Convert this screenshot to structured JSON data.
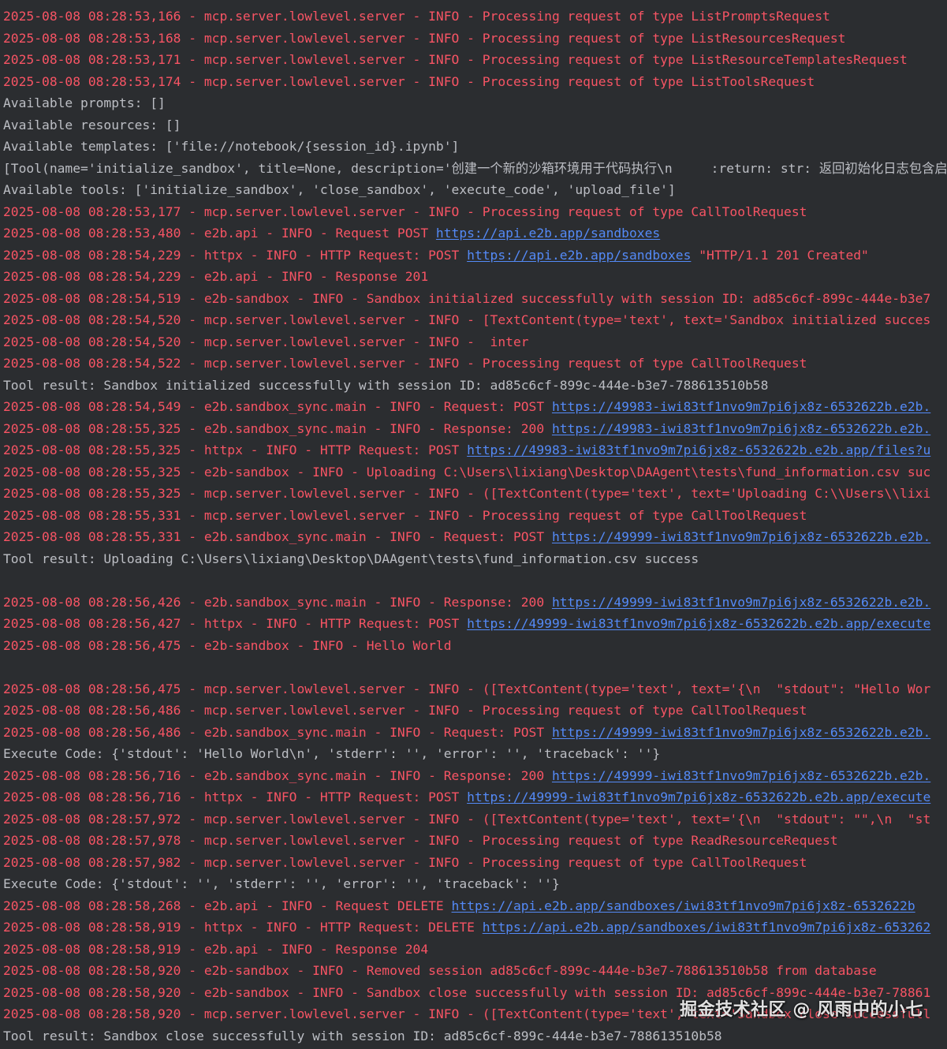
{
  "colors": {
    "background": "#2b2d30",
    "stderr_text": "#f75464",
    "stdout_text": "#bcbec4",
    "link": "#548af7"
  },
  "watermark": "掘金技术社区 @ 风雨中的小七",
  "lines": [
    {
      "kind": "err",
      "text": "2025-08-08 08:28:53,166 - mcp.server.lowlevel.server - INFO - Processing request of type ListPromptsRequest"
    },
    {
      "kind": "err",
      "text": "2025-08-08 08:28:53,168 - mcp.server.lowlevel.server - INFO - Processing request of type ListResourcesRequest"
    },
    {
      "kind": "err",
      "text": "2025-08-08 08:28:53,171 - mcp.server.lowlevel.server - INFO - Processing request of type ListResourceTemplatesRequest"
    },
    {
      "kind": "err",
      "text": "2025-08-08 08:28:53,174 - mcp.server.lowlevel.server - INFO - Processing request of type ListToolsRequest"
    },
    {
      "kind": "out",
      "text": "Available prompts: []"
    },
    {
      "kind": "out",
      "text": "Available resources: []"
    },
    {
      "kind": "out",
      "text": "Available templates: ['file://notebook/{session_id}.ipynb']"
    },
    {
      "kind": "out",
      "text": "[Tool(name='initialize_sandbox', title=None, description='创建一个新的沙箱环境用于代码执行\\n     :return: str: 返回初始化日志包含启"
    },
    {
      "kind": "out",
      "text": "Available tools: ['initialize_sandbox', 'close_sandbox', 'execute_code', 'upload_file']"
    },
    {
      "kind": "err",
      "text": "2025-08-08 08:28:53,177 - mcp.server.lowlevel.server - INFO - Processing request of type CallToolRequest"
    },
    {
      "kind": "err",
      "text": "2025-08-08 08:28:53,480 - e2b.api - INFO - Request POST ",
      "link": "https://api.e2b.app/sandboxes",
      "after": ""
    },
    {
      "kind": "err",
      "text": "2025-08-08 08:28:54,229 - httpx - INFO - HTTP Request: POST ",
      "link": "https://api.e2b.app/sandboxes",
      "after": " \"HTTP/1.1 201 Created\""
    },
    {
      "kind": "err",
      "text": "2025-08-08 08:28:54,229 - e2b.api - INFO - Response 201"
    },
    {
      "kind": "err",
      "text": "2025-08-08 08:28:54,519 - e2b-sandbox - INFO - Sandbox initialized successfully with session ID: ad85c6cf-899c-444e-b3e7"
    },
    {
      "kind": "err",
      "text": "2025-08-08 08:28:54,520 - mcp.server.lowlevel.server - INFO - [TextContent(type='text', text='Sandbox initialized succes"
    },
    {
      "kind": "err",
      "text": "2025-08-08 08:28:54,520 - mcp.server.lowlevel.server - INFO -  inter"
    },
    {
      "kind": "err",
      "text": "2025-08-08 08:28:54,522 - mcp.server.lowlevel.server - INFO - Processing request of type CallToolRequest"
    },
    {
      "kind": "out",
      "text": "Tool result: Sandbox initialized successfully with session ID: ad85c6cf-899c-444e-b3e7-788613510b58"
    },
    {
      "kind": "err",
      "text": "2025-08-08 08:28:54,549 - e2b.sandbox_sync.main - INFO - Request: POST ",
      "link": "https://49983-iwi83tf1nvo9m7pi6jx8z-6532622b.e2b.",
      "after": ""
    },
    {
      "kind": "err",
      "text": "2025-08-08 08:28:55,325 - e2b.sandbox_sync.main - INFO - Response: 200 ",
      "link": "https://49983-iwi83tf1nvo9m7pi6jx8z-6532622b.e2b.",
      "after": ""
    },
    {
      "kind": "err",
      "text": "2025-08-08 08:28:55,325 - httpx - INFO - HTTP Request: POST ",
      "link": "https://49983-iwi83tf1nvo9m7pi6jx8z-6532622b.e2b.app/files?u",
      "after": ""
    },
    {
      "kind": "err",
      "text": "2025-08-08 08:28:55,325 - e2b-sandbox - INFO - Uploading C:\\Users\\lixiang\\Desktop\\DAAgent\\tests\\fund_information.csv suc"
    },
    {
      "kind": "err",
      "text": "2025-08-08 08:28:55,325 - mcp.server.lowlevel.server - INFO - ([TextContent(type='text', text='Uploading C:\\\\Users\\\\lixi"
    },
    {
      "kind": "err",
      "text": "2025-08-08 08:28:55,331 - mcp.server.lowlevel.server - INFO - Processing request of type CallToolRequest"
    },
    {
      "kind": "err",
      "text": "2025-08-08 08:28:55,331 - e2b.sandbox_sync.main - INFO - Request: POST ",
      "link": "https://49999-iwi83tf1nvo9m7pi6jx8z-6532622b.e2b.",
      "after": ""
    },
    {
      "kind": "out",
      "text": "Tool result: Uploading C:\\Users\\lixiang\\Desktop\\DAAgent\\tests\\fund_information.csv success"
    },
    {
      "kind": "blank",
      "text": ""
    },
    {
      "kind": "err",
      "text": "2025-08-08 08:28:56,426 - e2b.sandbox_sync.main - INFO - Response: 200 ",
      "link": "https://49999-iwi83tf1nvo9m7pi6jx8z-6532622b.e2b.",
      "after": ""
    },
    {
      "kind": "err",
      "text": "2025-08-08 08:28:56,427 - httpx - INFO - HTTP Request: POST ",
      "link": "https://49999-iwi83tf1nvo9m7pi6jx8z-6532622b.e2b.app/execute",
      "after": ""
    },
    {
      "kind": "err",
      "text": "2025-08-08 08:28:56,475 - e2b-sandbox - INFO - Hello World"
    },
    {
      "kind": "blank",
      "text": ""
    },
    {
      "kind": "err",
      "text": "2025-08-08 08:28:56,475 - mcp.server.lowlevel.server - INFO - ([TextContent(type='text', text='{\\n  \"stdout\": \"Hello Wor"
    },
    {
      "kind": "err",
      "text": "2025-08-08 08:28:56,486 - mcp.server.lowlevel.server - INFO - Processing request of type CallToolRequest"
    },
    {
      "kind": "err",
      "text": "2025-08-08 08:28:56,486 - e2b.sandbox_sync.main - INFO - Request: POST ",
      "link": "https://49999-iwi83tf1nvo9m7pi6jx8z-6532622b.e2b.",
      "after": ""
    },
    {
      "kind": "out",
      "text": "Execute Code: {'stdout': 'Hello World\\n', 'stderr': '', 'error': '', 'traceback': ''}"
    },
    {
      "kind": "err",
      "text": "2025-08-08 08:28:56,716 - e2b.sandbox_sync.main - INFO - Response: 200 ",
      "link": "https://49999-iwi83tf1nvo9m7pi6jx8z-6532622b.e2b.",
      "after": ""
    },
    {
      "kind": "err",
      "text": "2025-08-08 08:28:56,716 - httpx - INFO - HTTP Request: POST ",
      "link": "https://49999-iwi83tf1nvo9m7pi6jx8z-6532622b.e2b.app/execute",
      "after": ""
    },
    {
      "kind": "err",
      "text": "2025-08-08 08:28:57,972 - mcp.server.lowlevel.server - INFO - ([TextContent(type='text', text='{\\n  \"stdout\": \"\",\\n  \"st"
    },
    {
      "kind": "err",
      "text": "2025-08-08 08:28:57,978 - mcp.server.lowlevel.server - INFO - Processing request of type ReadResourceRequest"
    },
    {
      "kind": "err",
      "text": "2025-08-08 08:28:57,982 - mcp.server.lowlevel.server - INFO - Processing request of type CallToolRequest"
    },
    {
      "kind": "out",
      "text": "Execute Code: {'stdout': '', 'stderr': '', 'error': '', 'traceback': ''}"
    },
    {
      "kind": "err",
      "text": "2025-08-08 08:28:58,268 - e2b.api - INFO - Request DELETE ",
      "link": "https://api.e2b.app/sandboxes/iwi83tf1nvo9m7pi6jx8z-6532622b",
      "after": ""
    },
    {
      "kind": "err",
      "text": "2025-08-08 08:28:58,919 - httpx - INFO - HTTP Request: DELETE ",
      "link": "https://api.e2b.app/sandboxes/iwi83tf1nvo9m7pi6jx8z-653262",
      "after": ""
    },
    {
      "kind": "err",
      "text": "2025-08-08 08:28:58,919 - e2b.api - INFO - Response 204"
    },
    {
      "kind": "err",
      "text": "2025-08-08 08:28:58,920 - e2b-sandbox - INFO - Removed session ad85c6cf-899c-444e-b3e7-788613510b58 from database"
    },
    {
      "kind": "err",
      "text": "2025-08-08 08:28:58,920 - e2b-sandbox - INFO - Sandbox close successfully with session ID: ad85c6cf-899c-444e-b3e7-78861"
    },
    {
      "kind": "err",
      "text": "2025-08-08 08:28:58,920 - mcp.server.lowlevel.server - INFO - ([TextContent(type='text', text='Sandbox close successfull"
    },
    {
      "kind": "out",
      "text": "Tool result: Sandbox close successfully with session ID: ad85c6cf-899c-444e-b3e7-788613510b58"
    }
  ]
}
